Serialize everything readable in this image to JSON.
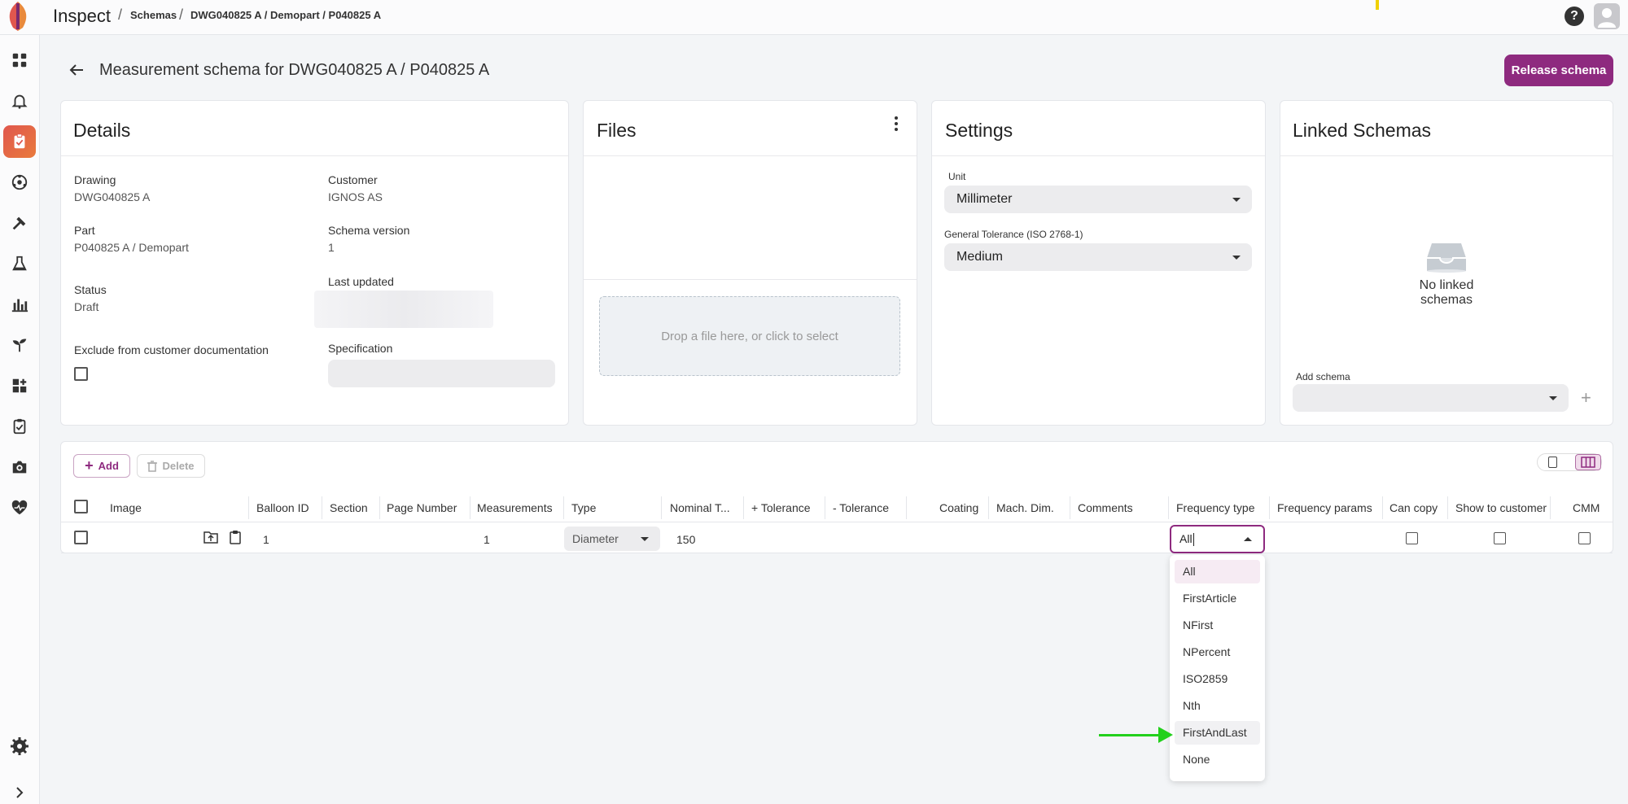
{
  "app": {
    "title": "Inspect"
  },
  "breadcrumb": [
    "Schemas",
    "DWG040825 A / Demopart / P040825 A"
  ],
  "header": {
    "title": "Measurement schema for DWG040825 A / P040825 A",
    "release_label": "Release schema"
  },
  "details": {
    "title": "Details",
    "drawing_label": "Drawing",
    "drawing_value": "DWG040825 A",
    "customer_label": "Customer",
    "customer_value": "IGNOS AS",
    "part_label": "Part",
    "part_value": "P040825 A / Demopart",
    "schema_version_label": "Schema version",
    "schema_version_value": "1",
    "status_label": "Status",
    "status_value": "Draft",
    "last_updated_label": "Last updated",
    "exclude_label": "Exclude from customer documentation",
    "specification_label": "Specification"
  },
  "files": {
    "title": "Files",
    "dropzone_text": "Drop a file here, or click to select"
  },
  "settings": {
    "title": "Settings",
    "unit_label": "Unit",
    "unit_value": "Millimeter",
    "tolerance_label": "General Tolerance (ISO 2768-1)",
    "tolerance_value": "Medium"
  },
  "linked": {
    "title": "Linked Schemas",
    "empty_text": "No linked schemas",
    "add_schema_label": "Add schema"
  },
  "toolbar": {
    "add_label": "Add",
    "delete_label": "Delete"
  },
  "table": {
    "headers": [
      "Image",
      "Balloon ID",
      "Section",
      "Page Number",
      "Measurements",
      "Type",
      "Nominal T...",
      "+ Tolerance",
      "- Tolerance",
      "Coating",
      "Mach. Dim.",
      "Comments",
      "Frequency type",
      "Frequency params",
      "Can copy",
      "Show to customer",
      "CMM"
    ],
    "row": {
      "balloon_id": "1",
      "measurements": "1",
      "type": "Diameter",
      "nominal": "150",
      "frequency_type": "All"
    }
  },
  "frequency_options": [
    "All",
    "FirstArticle",
    "NFirst",
    "NPercent",
    "ISO2859",
    "Nth",
    "FirstAndLast",
    "None"
  ],
  "colors": {
    "accent": "#8e2a7f",
    "arrow": "#22d01c",
    "active_nav": "#e0574e"
  }
}
